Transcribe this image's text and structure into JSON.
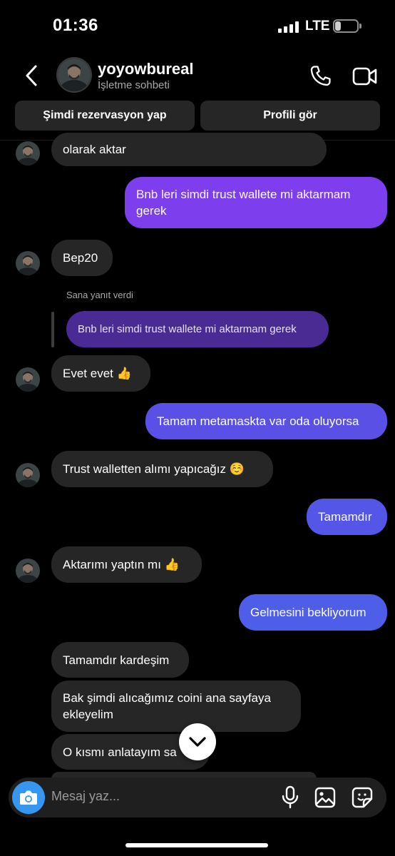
{
  "status_bar": {
    "time": "01:36",
    "network": "LTE",
    "battery": "25",
    "battery_level": 0.25
  },
  "header": {
    "username": "yoyowbureal",
    "subtitle": "İşletme sohbeti",
    "back_icon": "chevron-left-icon",
    "call_icon": "phone-icon",
    "video_icon": "video-camera-icon"
  },
  "actions": {
    "reservation_label": "Şimdi rezervasyon yap",
    "profile_label": "Profili gör"
  },
  "messages": {
    "m1": "olarak aktar",
    "m2": "Bnb leri simdi trust wallete mi aktarmam gerek",
    "m3": "Bep20",
    "reply_label": "Sana yanıt verdi",
    "reply_quote": "Bnb leri simdi trust wallete mi aktarmam gerek",
    "m4": "Evet evet 👍",
    "m5": "Tamam metamaskta var oda oluyorsa",
    "m6": "Trust walletten alımı yapıcağız ☺️",
    "m7": "Tamamdır",
    "m8": "Aktarımı yaptın mı 👍",
    "m9": "Gelmesini bekliyorum",
    "m10": "Tamamdır kardeşim",
    "m11": "Bak şimdi alıcağımız coini ana sayfaya ekleyelim",
    "m12": "O kısmı anlatayım sa"
  },
  "composer": {
    "placeholder": "Mesaj yaz..."
  },
  "colors": {
    "sent_top": "#8a3ff0",
    "sent_bottom": "#4f5ee8",
    "received": "#262626",
    "reply_quote": "#4a2b93",
    "camera": "#3797f0"
  }
}
